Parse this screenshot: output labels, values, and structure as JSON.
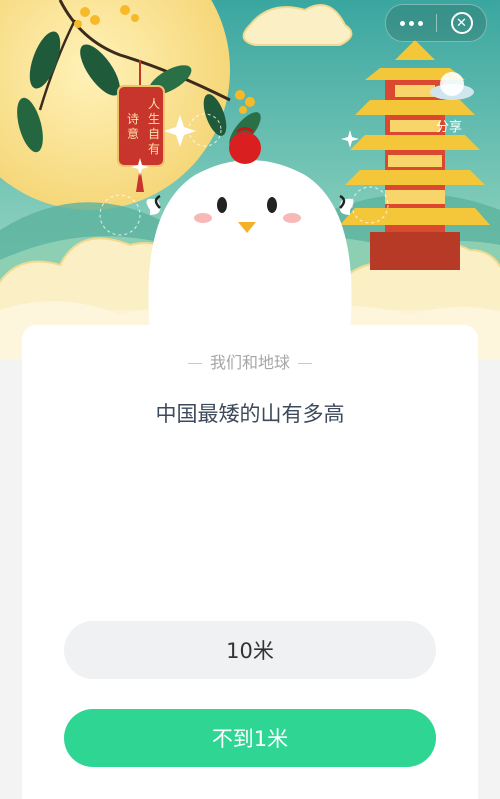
{
  "banner": {
    "tag_text": "人生自有诗意",
    "share_text": "分享"
  },
  "capsule": {
    "more_icon": "ellipsis-icon",
    "close_icon": "close-circle-icon"
  },
  "quiz": {
    "category": "我们和地球",
    "question": "中国最矮的山有多高",
    "options": [
      "10米",
      "不到1米"
    ]
  },
  "colors": {
    "accent": "#2fd693",
    "option_bg": "#f0f1f3",
    "question_text": "#3d4a5c"
  }
}
